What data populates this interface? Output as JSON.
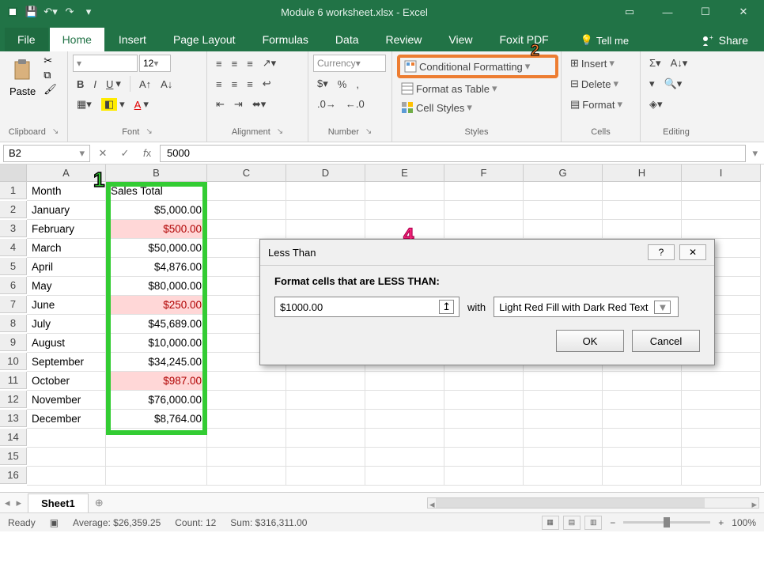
{
  "title": "Module 6 worksheet.xlsx - Excel",
  "tabs": {
    "file": "File",
    "home": "Home",
    "insert": "Insert",
    "pagelayout": "Page Layout",
    "formulas": "Formulas",
    "data": "Data",
    "review": "Review",
    "view": "View",
    "foxit": "Foxit PDF"
  },
  "tellme": "Tell me",
  "share": "Share",
  "ribbon": {
    "clipboard": {
      "paste": "Paste",
      "label": "Clipboard"
    },
    "font": {
      "size": "12",
      "label": "Font"
    },
    "alignment": {
      "label": "Alignment"
    },
    "number": {
      "format": "Currency",
      "label": "Number"
    },
    "styles": {
      "cond": "Conditional Formatting",
      "table": "Format as Table",
      "cell": "Cell Styles",
      "label": "Styles"
    },
    "cells": {
      "insert": "Insert",
      "delete": "Delete",
      "format": "Format",
      "label": "Cells"
    },
    "editing": {
      "label": "Editing"
    }
  },
  "namebox": "B2",
  "formula": "5000",
  "cols": [
    "A",
    "B",
    "C",
    "D",
    "E",
    "F",
    "G",
    "H",
    "I"
  ],
  "rows": [
    {
      "n": "1",
      "a": "Month",
      "b": "Sales Total",
      "balign": "left",
      "bred": false
    },
    {
      "n": "2",
      "a": "January",
      "b": "$5,000.00",
      "balign": "right",
      "bred": false
    },
    {
      "n": "3",
      "a": "February",
      "b": "$500.00",
      "balign": "right",
      "bred": true
    },
    {
      "n": "4",
      "a": "March",
      "b": "$50,000.00",
      "balign": "right",
      "bred": false
    },
    {
      "n": "5",
      "a": "April",
      "b": "$4,876.00",
      "balign": "right",
      "bred": false
    },
    {
      "n": "6",
      "a": "May",
      "b": "$80,000.00",
      "balign": "right",
      "bred": false
    },
    {
      "n": "7",
      "a": "June",
      "b": "$250.00",
      "balign": "right",
      "bred": true
    },
    {
      "n": "8",
      "a": "July",
      "b": "$45,689.00",
      "balign": "right",
      "bred": false
    },
    {
      "n": "9",
      "a": "August",
      "b": "$10,000.00",
      "balign": "right",
      "bred": false
    },
    {
      "n": "10",
      "a": "September",
      "b": "$34,245.00",
      "balign": "right",
      "bred": false
    },
    {
      "n": "11",
      "a": "October",
      "b": "$987.00",
      "balign": "right",
      "bred": true
    },
    {
      "n": "12",
      "a": "November",
      "b": "$76,000.00",
      "balign": "right",
      "bred": false
    },
    {
      "n": "13",
      "a": "December",
      "b": "$8,764.00",
      "balign": "right",
      "bred": false
    },
    {
      "n": "14",
      "a": "",
      "b": "",
      "balign": "left",
      "bred": false
    },
    {
      "n": "15",
      "a": "",
      "b": "",
      "balign": "left",
      "bred": false
    },
    {
      "n": "16",
      "a": "",
      "b": "",
      "balign": "left",
      "bred": false
    }
  ],
  "dialog": {
    "title": "Less Than",
    "prompt": "Format cells that are LESS THAN:",
    "value": "$1000.00",
    "with": "with",
    "style": "Light Red Fill with Dark Red Text",
    "ok": "OK",
    "cancel": "Cancel"
  },
  "annotations": {
    "n1": "1",
    "n2": "2",
    "n4": "4"
  },
  "sheettab": "Sheet1",
  "status": {
    "ready": "Ready",
    "avg": "Average: $26,359.25",
    "count": "Count: 12",
    "sum": "Sum: $316,311.00",
    "zoom": "100%"
  }
}
